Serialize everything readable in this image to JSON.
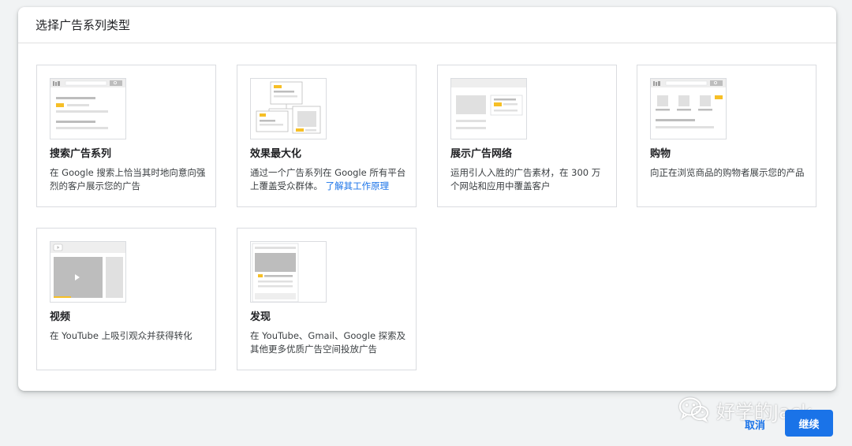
{
  "dialog": {
    "title": "选择广告系列类型"
  },
  "cards": [
    {
      "title": "搜索广告系列",
      "desc": "在 Google 搜索上恰当其时地向意向强烈的客户展示您的广告"
    },
    {
      "title": "效果最大化",
      "desc": "通过一个广告系列在 Google 所有平台上覆盖受众群体。",
      "link": "了解其工作原理"
    },
    {
      "title": "展示广告网络",
      "desc": "运用引人入胜的广告素材，在 300 万个网站和应用中覆盖客户"
    },
    {
      "title": "购物",
      "desc": "向正在浏览商品的购物者展示您的产品"
    },
    {
      "title": "视频",
      "desc": "在 YouTube 上吸引观众并获得转化"
    },
    {
      "title": "发现",
      "desc": "在 YouTube、Gmail、Google 探索及其他更多优质广告空间投放广告"
    }
  ],
  "actions": {
    "cancel": "取消",
    "continue": "继续"
  },
  "watermark": {
    "text": "好学的Jack",
    "icon": "wechat-icon"
  },
  "colors": {
    "accent": "#1a73e8",
    "highlight": "#f6bf26",
    "placeholder": "#dadce0"
  }
}
